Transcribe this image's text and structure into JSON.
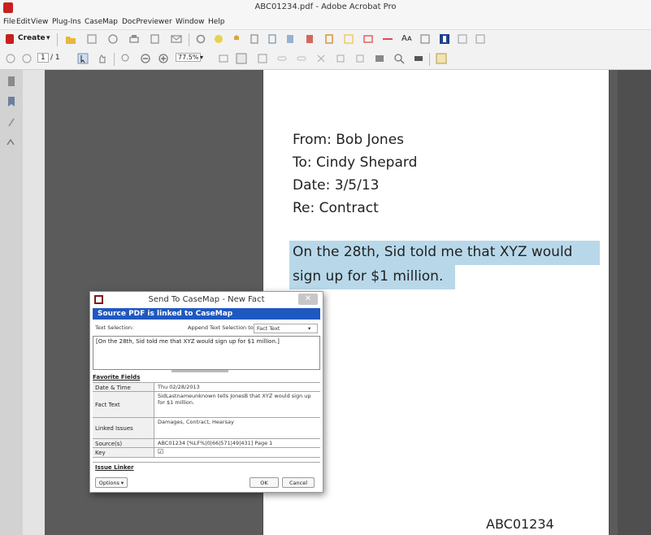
{
  "window": {
    "title": "ABC01234.pdf - Adobe Acrobat Pro"
  },
  "menu": [
    "File",
    "Edit",
    "View",
    "Plug-Ins",
    "CaseMap",
    "DocPreviewer",
    "Window",
    "Help"
  ],
  "toolbar": {
    "create_label": "Create",
    "page_current": "1",
    "page_total": "/ 1",
    "zoom_value": "77.5%",
    "icons": [
      "create-icon",
      "open-folder-icon",
      "save-icon",
      "share-icon",
      "print-icon",
      "edit-icon",
      "email-icon",
      "settings-icon",
      "comment-icon",
      "stamp-icon",
      "attach-icon",
      "pages-icon",
      "combine-icon",
      "export-icon",
      "sign-icon",
      "highlight-icon",
      "rectangle-icon",
      "line-icon",
      "text-size-icon",
      "typewriter-icon",
      "casemap-icon",
      "redact-icon",
      "more-icon"
    ]
  },
  "document": {
    "from": "From: Bob Jones",
    "to": "To: Cindy Shepard",
    "date": "Date: 3/5/13",
    "re": "Re: Contract",
    "body_line1": "On the 28th, Sid told me that XYZ would",
    "body_line2": "sign up for $1 million.",
    "footer_number": "ABC01234",
    "highlight_color": "#b8d8ea"
  },
  "dialog": {
    "title": "Send To CaseMap - New Fact",
    "banner": "Source PDF is linked to CaseMap",
    "text_selection_label": "Text Selection:",
    "append_label": "Append Text Selection to:",
    "append_value": "Fact Text",
    "selected_text": "[On the 28th, Sid told me that XYZ would sign up for $1 million.]",
    "favorite_fields_label": "Favorite Fields",
    "fields": [
      {
        "key": "Date & Time",
        "value": "Thu 02/28/2013"
      },
      {
        "key": "Fact Text",
        "value": "SidLastnameunknown tells JonesB that XYZ would sign up for $1 million."
      },
      {
        "key": "Linked Issues",
        "value": "Damages, Contract, Hearsay"
      },
      {
        "key": "Source(s)",
        "value": "ABC01234 [%LF%|0|66|571|49|431] Page 1"
      },
      {
        "key": "Key",
        "value": "☑"
      }
    ],
    "issue_linker_label": "Issue Linker",
    "options_label": "Options ▾",
    "ok_label": "OK",
    "cancel_label": "Cancel",
    "banner_color": "#1f58c0"
  }
}
